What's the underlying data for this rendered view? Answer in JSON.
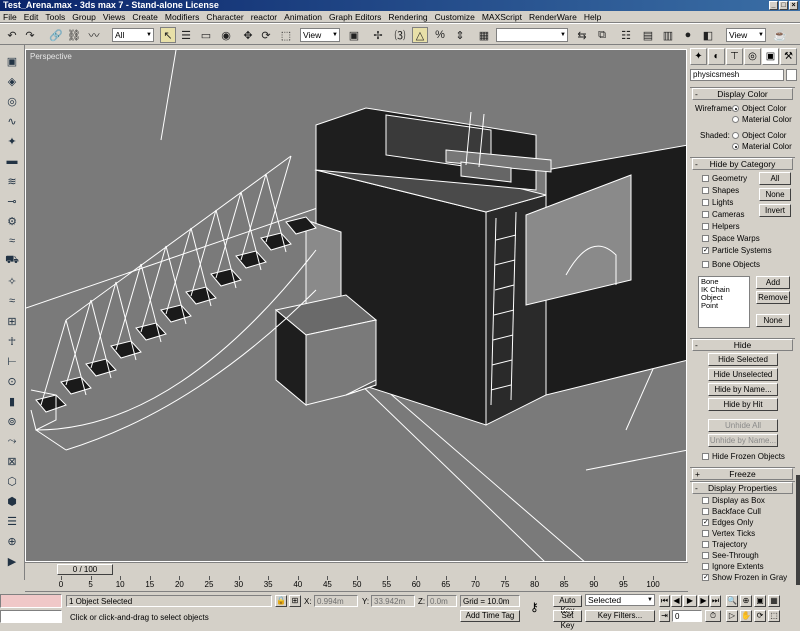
{
  "window": {
    "title": "Test_Arena.max - 3ds max 7 - Stand-alone License",
    "controls": [
      "_",
      "□",
      "×"
    ]
  },
  "menu": [
    "File",
    "Edit",
    "Tools",
    "Group",
    "Views",
    "Create",
    "Modifiers",
    "Character",
    "reactor",
    "Animation",
    "Graph Editors",
    "Rendering",
    "Customize",
    "MAXScript",
    "RenderWare",
    "Help"
  ],
  "toolbar": {
    "selection_filter": "All",
    "ref_coord": "View",
    "named_selection": "",
    "view_dropdown": "View"
  },
  "viewport": {
    "label": "Perspective"
  },
  "command_panel": {
    "object_name": "physicsmesh",
    "display_color": {
      "header": "Display Color",
      "wireframe_label": "Wireframe:",
      "shaded_label": "Shaded:",
      "object_color": "Object Color",
      "material_color": "Material Color"
    },
    "hide_by_category": {
      "header": "Hide by Category",
      "items": [
        {
          "label": "Geometry",
          "checked": false
        },
        {
          "label": "Shapes",
          "checked": false
        },
        {
          "label": "Lights",
          "checked": false
        },
        {
          "label": "Cameras",
          "checked": false
        },
        {
          "label": "Helpers",
          "checked": false
        },
        {
          "label": "Space Warps",
          "checked": false
        },
        {
          "label": "Particle Systems",
          "checked": true
        },
        {
          "label": "Bone Objects",
          "checked": false
        }
      ],
      "all": "All",
      "none": "None",
      "invert": "Invert",
      "list": [
        "Bone",
        "IK Chain Object",
        "Point"
      ],
      "add": "Add",
      "remove": "Remove",
      "none2": "None"
    },
    "hide": {
      "header": "Hide",
      "hide_selected": "Hide Selected",
      "hide_unselected": "Hide Unselected",
      "hide_by_name": "Hide by Name...",
      "hide_by_hit": "Hide by Hit",
      "unhide_all": "Unhide All",
      "unhide_by_name": "Unhide by Name...",
      "hide_frozen": "Hide Frozen Objects"
    },
    "freeze": {
      "header": "Freeze"
    },
    "display_properties": {
      "header": "Display Properties",
      "items": [
        {
          "label": "Display as Box",
          "checked": false
        },
        {
          "label": "Backface Cull",
          "checked": false
        },
        {
          "label": "Edges Only",
          "checked": true
        },
        {
          "label": "Vertex Ticks",
          "checked": false
        },
        {
          "label": "Trajectory",
          "checked": false
        },
        {
          "label": "See-Through",
          "checked": false
        },
        {
          "label": "Ignore Extents",
          "checked": false
        },
        {
          "label": "Show Frozen in Gray",
          "checked": true
        }
      ]
    }
  },
  "timeline": {
    "slider_label": "0 / 100",
    "ticks": [
      "0",
      "5",
      "10",
      "15",
      "20",
      "25",
      "30",
      "35",
      "40",
      "45",
      "50",
      "55",
      "60",
      "65",
      "70",
      "75",
      "80",
      "85",
      "90",
      "95",
      "100"
    ]
  },
  "status": {
    "selected": "1 Object Selected",
    "prompt": "Click or click-and-drag to select objects",
    "x_label": "X:",
    "x_value": "0.994m",
    "y_label": "Y:",
    "y_value": "33.942m",
    "z_label": "Z:",
    "z_value": "0.0m",
    "grid": "Grid = 10.0m",
    "add_time_tag": "Add Time Tag",
    "auto_key": "Auto Key",
    "set_key": "Set Key",
    "key_mode": "Selected",
    "key_filters": "Key Filters...",
    "frame": "0"
  }
}
